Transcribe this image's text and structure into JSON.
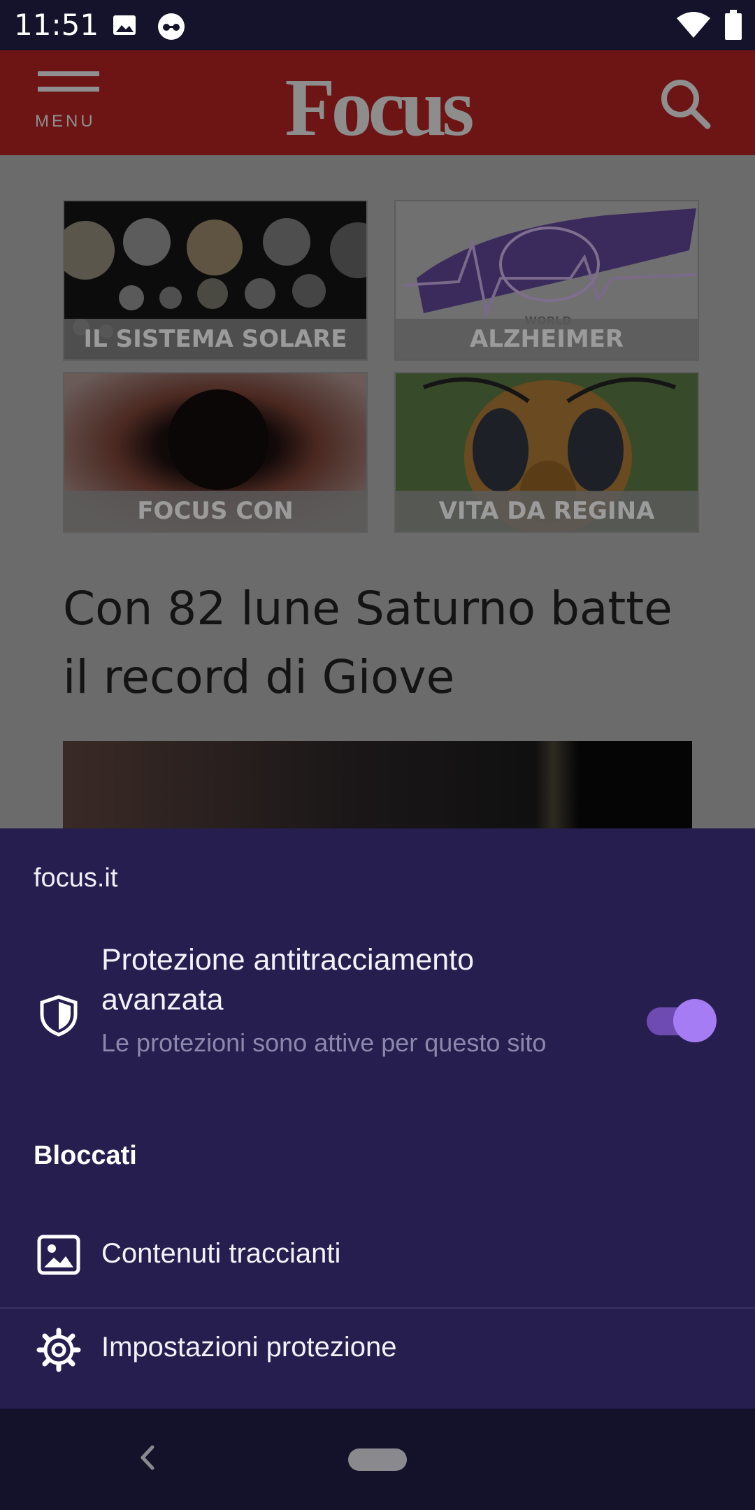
{
  "status_bar": {
    "time": "11:51",
    "icons": [
      "image-icon",
      "incognito-icon",
      "wifi-icon",
      "battery-icon"
    ]
  },
  "header": {
    "menu_label": "MENU",
    "logo_text": "Focus",
    "search_icon": "search-icon"
  },
  "tiles": [
    {
      "label": "IL SISTEMA SOLARE"
    },
    {
      "label": "ALZHEIMER"
    },
    {
      "label": "FOCUS CON"
    },
    {
      "label": "VITA DA REGINA"
    }
  ],
  "article": {
    "headline": "Con 82 lune Saturno batte il record di Giove"
  },
  "sheet": {
    "domain": "focus.it",
    "protection_title": "Protezione antitracciamento avanzata",
    "protection_subtitle": "Le protezioni sono attive per questo sito",
    "protection_enabled": true,
    "blocked_title": "Bloccati",
    "blocked_item": "Contenuti traccianti",
    "settings_item": "Impostazioni protezione"
  },
  "colors": {
    "sheet_bg": "#261e4e",
    "toggle_accent": "#a57cf3",
    "header_bg": "#6d1414"
  }
}
